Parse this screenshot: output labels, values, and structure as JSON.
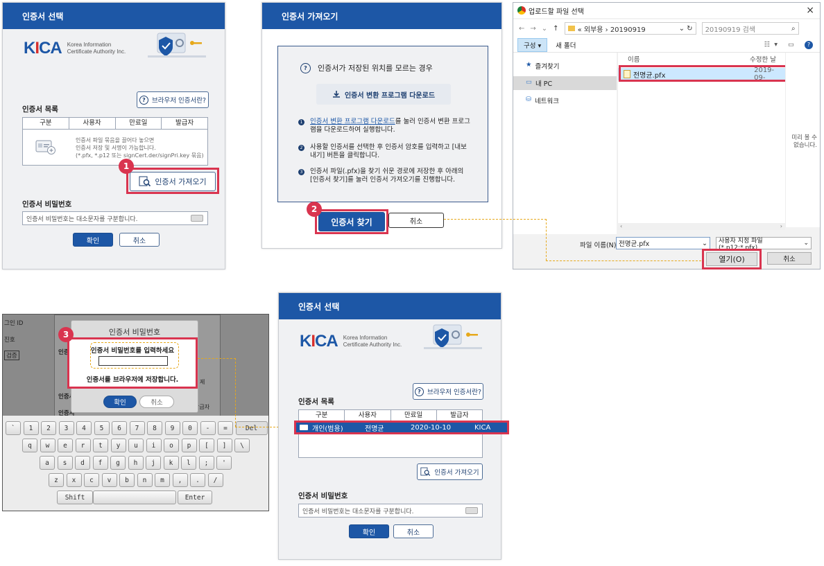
{
  "panel1": {
    "title": "인증서 선택",
    "kica_logo": "KICA",
    "kica_subtitle_1": "Korea Information",
    "kica_subtitle_2": "Certificate Authority Inc.",
    "browser_cert_button": "브라우저 인증서란?",
    "cert_list_label": "인증서 목록",
    "columns": [
      "구분",
      "사용자",
      "만료일",
      "발급자"
    ],
    "empty_hint_1": "인증서 파일 묶음을 끌어다 놓으면",
    "empty_hint_2": "인증서 저장 및 서명이 가능합니다.",
    "empty_hint_3": "(*.pfx, *.p12 또는 signCert.der/signPri.key 묶음)",
    "import_button": "인증서 가져오기",
    "password_label": "인증서 비밀번호",
    "password_placeholder": "인증서 비밀번호는 대소문자를 구분합니다.",
    "confirm_button": "확인",
    "cancel_button": "취소",
    "step_badge": "1"
  },
  "panel2": {
    "title": "인증서 가져오기",
    "question": "인증서가 저장된 위치를 모르는 경우",
    "download_button": "인증서 변환 프로그램 다운로드",
    "step1_link": "인증서 변환 프로그램 다운로드",
    "step1_rest": "를 눌러 인증서 변환 프로그램을 다운로드하여 실행합니다.",
    "step2": "사용할 인증서를 선택한 후 인증서 암호를 입력하고 [내보내기] 버튼을 클릭합니다.",
    "step3": "인증서 파일(.pfx)을 찾기 쉬운 경로에 저장한 후 아래의 [인증서 찾기]를 눌러 인증서 가져오기를 진행합니다.",
    "find_button": "인증서 찾기",
    "cancel_button": "취소",
    "step_badge": "2"
  },
  "file_dialog": {
    "title": "업로드할 파일 선택",
    "breadcrumb": "« 외부용 › 20190919",
    "search_placeholder": "20190919 검색",
    "organize": "구성 ▾",
    "new_folder": "새 폴더",
    "col_name": "이름",
    "col_modified": "수정한 날",
    "favorites": "즐겨찾기",
    "this_pc": "내 PC",
    "network": "네트워크",
    "file_name": "전명균.pfx",
    "file_date": "2019-09-",
    "preview_text_1": "미리 볼 수",
    "preview_text_2": "없습니다.",
    "filename_label": "파일 이름(N):",
    "filename_value": "전명균.pfx",
    "filter": "사용자 지정 파일 (*.p12;*.pfx)",
    "open_button": "열기(O)",
    "cancel_button": "취소"
  },
  "keyboard_panel": {
    "side_labels": [
      "그인 ID",
      "진호",
      "검증"
    ],
    "bg_labels": [
      "인증",
      "인증서",
      "인증서",
      "발급자",
      "제"
    ],
    "dialog_title": "인증서 비밀번호",
    "prompt": "인증서 비밀번호를 입력하세요",
    "save_note": "인증서를 브라우저에 저장합니다.",
    "confirm_button": "확인",
    "cancel_button": "취소",
    "step_badge": "3",
    "row1": [
      "`",
      "1",
      "2",
      "3",
      "4",
      "5",
      "6",
      "7",
      "8",
      "9",
      "0",
      "-",
      "=",
      "Del"
    ],
    "row2": [
      "q",
      "w",
      "e",
      "r",
      "t",
      "y",
      "u",
      "i",
      "o",
      "p",
      "[",
      "]",
      "\\"
    ],
    "row3": [
      "a",
      "s",
      "d",
      "f",
      "g",
      "h",
      "j",
      "k",
      "l",
      ";",
      "'"
    ],
    "row4": [
      "z",
      "x",
      "c",
      "v",
      "b",
      "n",
      "m",
      ",",
      ".",
      "/"
    ],
    "shift": "Shift",
    "enter": "Enter"
  },
  "panel4": {
    "title": "인증서 선택",
    "kica_logo": "KICA",
    "kica_subtitle_1": "Korea Information",
    "kica_subtitle_2": "Certificate Authority Inc.",
    "browser_cert_button": "브라우저 인증서란?",
    "cert_list_label": "인증서 목록",
    "columns": [
      "구분",
      "사용자",
      "만료일",
      "발급자"
    ],
    "row": {
      "type": "개인(범용)",
      "user": "전명균",
      "expiry": "2020-10-10",
      "issuer": "KICA"
    },
    "import_button": "인증서 가져오기",
    "password_label": "인증서 비밀번호",
    "password_placeholder": "인증서 비밀번호는 대소문자를 구분합니다.",
    "confirm_button": "확인",
    "cancel_button": "취소"
  },
  "colors": {
    "brand_blue": "#1d57a6",
    "highlight_red": "#d9344f",
    "guide_yellow": "#e6a81a"
  }
}
